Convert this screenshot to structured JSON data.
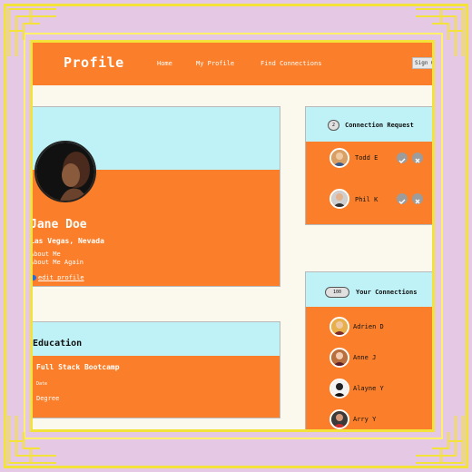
{
  "navbar": {
    "brand": "Profile",
    "links": [
      "Home",
      "My Profile",
      "Find Connections"
    ],
    "button_label": "Sign Out"
  },
  "profile": {
    "name": "Jane Doe",
    "location": "Las Vegas, Nevada",
    "about_lines": [
      "About Me",
      "About Me Again"
    ],
    "edit_label": "edit profile"
  },
  "education": {
    "title": "Education",
    "program": "Full Stack Bootcamp",
    "date": "Date",
    "degree": "Degree"
  },
  "requests": {
    "count": "2",
    "title": "Connection Request",
    "people": [
      {
        "name": "Todd E"
      },
      {
        "name": "Phil K"
      }
    ]
  },
  "connections": {
    "count": "100",
    "title": "Your Connections",
    "people": [
      {
        "name": "Adrien D"
      },
      {
        "name": "Anne J"
      },
      {
        "name": "Alayne Y"
      },
      {
        "name": "Arry Y"
      }
    ]
  },
  "colors": {
    "accent": "#fb7f2a",
    "sky": "#bff2f6",
    "frame": "#f3e23a",
    "backdrop": "#e4c8e4"
  }
}
